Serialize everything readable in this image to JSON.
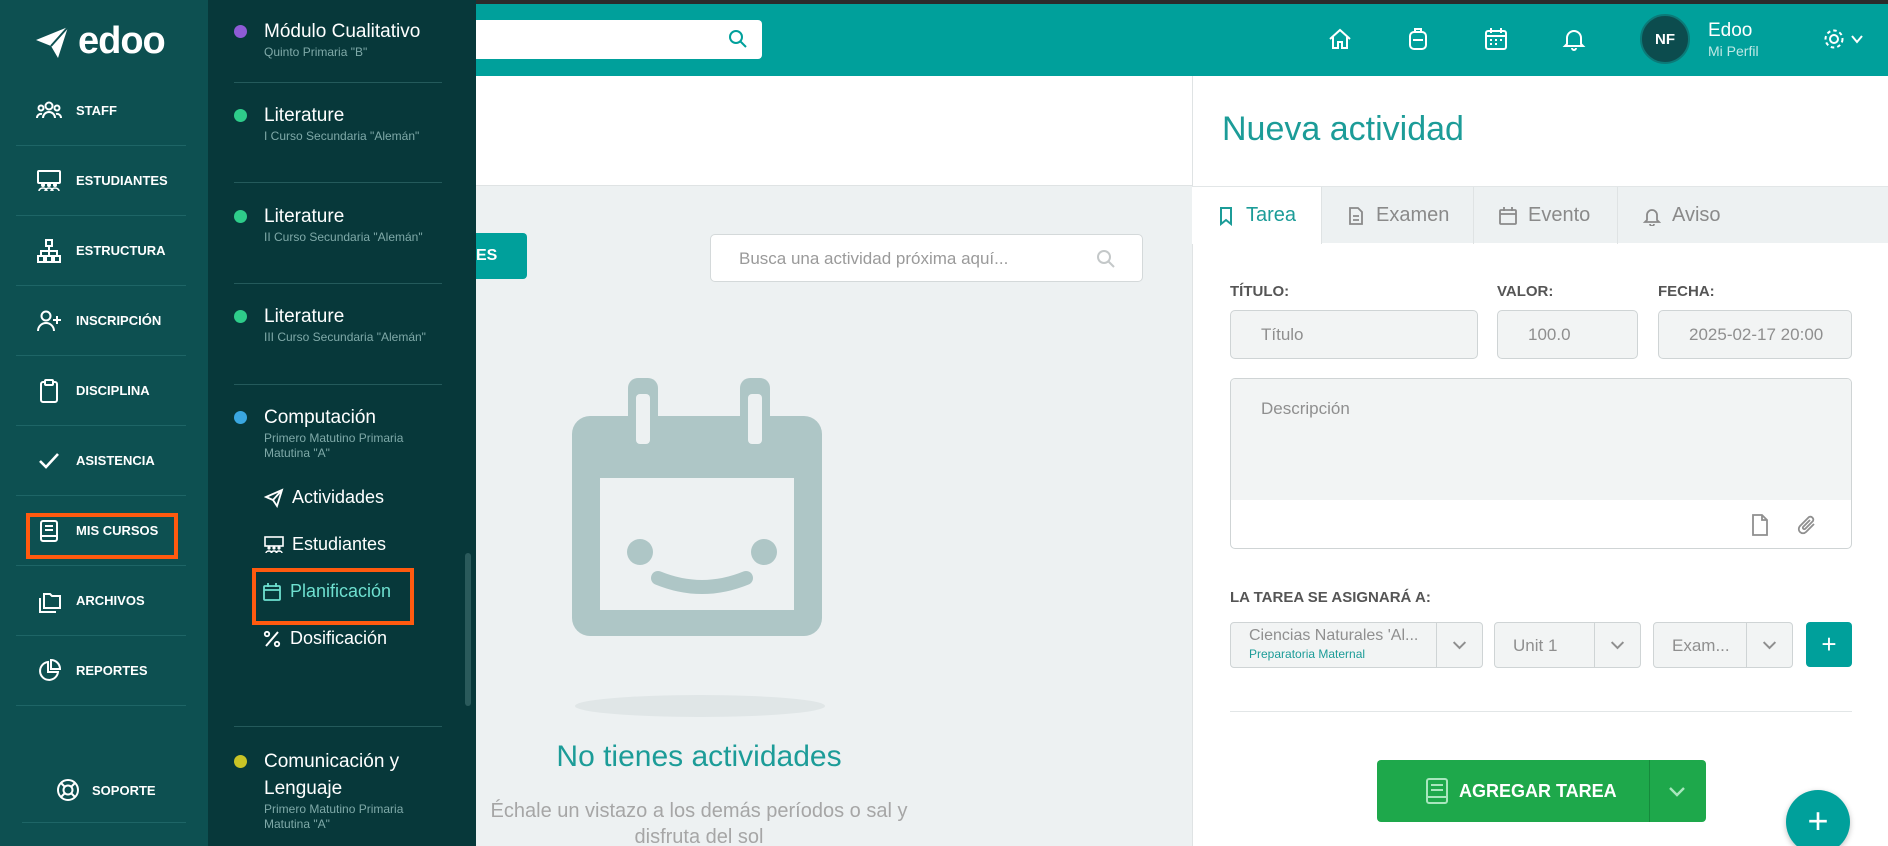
{
  "header": {
    "search_placeholder": "",
    "user_initials": "NF",
    "user_name": "Edoo",
    "user_subtitle": "Mi Perfil"
  },
  "brand": {
    "logo_text": "edoo"
  },
  "rail": {
    "items": [
      {
        "label": "STAFF",
        "icon": "staff-icon"
      },
      {
        "label": "ESTUDIANTES",
        "icon": "students-icon"
      },
      {
        "label": "ESTRUCTURA",
        "icon": "structure-icon"
      },
      {
        "label": "INSCRIPCIÓN",
        "icon": "enrollment-icon"
      },
      {
        "label": "DISCIPLINA",
        "icon": "clipboard-icon"
      },
      {
        "label": "ASISTENCIA",
        "icon": "check-icon"
      },
      {
        "label": "MIS CURSOS",
        "icon": "book-icon"
      },
      {
        "label": "ARCHIVOS",
        "icon": "files-icon"
      },
      {
        "label": "REPORTES",
        "icon": "chart-pie-icon"
      }
    ],
    "support_label": "SOPORTE"
  },
  "courses": {
    "list": [
      {
        "title": "Módulo Cualitativo",
        "subtitle": "Quinto Primaria \"B\"",
        "color": "#8e5bd6"
      },
      {
        "title": "Literature",
        "subtitle": "I Curso Secundaria \"Alemán\"",
        "color": "#2ecc8a"
      },
      {
        "title": "Literature",
        "subtitle": "II Curso Secundaria \"Alemán\"",
        "color": "#2ecc8a"
      },
      {
        "title": "Literature",
        "subtitle": "III Curso Secundaria \"Alemán\"",
        "color": "#2ecc8a"
      },
      {
        "title": "Computación",
        "subtitle": "Primero Matutino Primaria Matutina \"A\"",
        "color": "#3aa7e0"
      },
      {
        "title": "Comunicación y Lenguaje",
        "subtitle": "Primero Matutino Primaria Matutina \"A\"",
        "color": "#c9c426"
      }
    ],
    "submenu": [
      {
        "label": "Actividades",
        "icon": "paper-plane-icon"
      },
      {
        "label": "Estudiantes",
        "icon": "students-icon"
      },
      {
        "label": "Planificación",
        "icon": "calendar-icon"
      },
      {
        "label": "Dosificación",
        "icon": "percent-icon"
      }
    ]
  },
  "main": {
    "button_partial": "ES",
    "search_placeholder": "Busca una actividad próxima aquí...",
    "empty_title": "No tienes actividades",
    "empty_subtitle": "Échale un vistazo a los demás períodos o sal y disfruta del sol"
  },
  "panel": {
    "title": "Nueva actividad",
    "tabs": [
      {
        "label": "Tarea",
        "icon": "bookmark-icon"
      },
      {
        "label": "Examen",
        "icon": "document-icon"
      },
      {
        "label": "Evento",
        "icon": "calendar-icon"
      },
      {
        "label": "Aviso",
        "icon": "bell-icon"
      }
    ],
    "form": {
      "title_label": "TÍTULO:",
      "title_placeholder": "Título",
      "value_label": "VALOR:",
      "value": "100.0",
      "date_label": "FECHA:",
      "date": "2025-02-17 20:00",
      "description_placeholder": "Descripción",
      "assign_label": "LA TAREA SE ASIGNARÁ A:",
      "course_select": "Ciencias Naturales 'Al...",
      "course_select_sub": "Preparatoria Maternal",
      "unit_select": "Unit 1",
      "type_select": "Exam...",
      "plus": "+"
    },
    "submit_label": "AGREGAR TAREA",
    "fab": "+"
  },
  "colors": {
    "accent": "#00a09b",
    "rail": "#0d5051",
    "flyout": "#07383a",
    "highlight": "#ff5a0f",
    "success": "#1ea84b"
  }
}
